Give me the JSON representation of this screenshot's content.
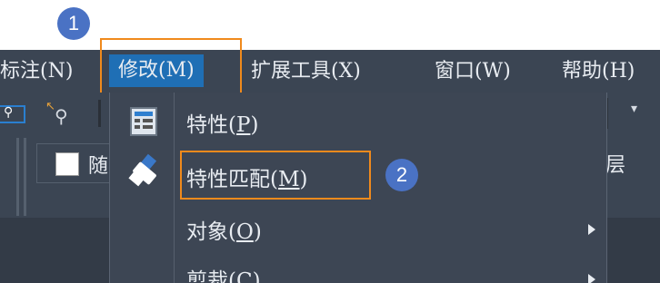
{
  "callouts": {
    "one": "1",
    "two": "2"
  },
  "menubar": {
    "items": [
      {
        "label": "标注(N)"
      },
      {
        "label": "修改(M)"
      },
      {
        "label": "扩展工具(X)"
      },
      {
        "label": "窗口(W)"
      },
      {
        "label": "帮助(H)"
      }
    ]
  },
  "toolbar": {
    "color_label": "随",
    "layer_label": "层"
  },
  "dropdown": {
    "items": [
      {
        "text": "特性(",
        "key": "P",
        "close": ")",
        "icon": "properties-icon"
      },
      {
        "text": "特性匹配(",
        "key": "M",
        "close": ")",
        "icon": "match-properties-brush-icon"
      },
      {
        "text": "对象(",
        "key": "O",
        "close": ")",
        "has_submenu": true
      },
      {
        "text": "剪裁(",
        "key": "C",
        "close": ")",
        "has_submenu": true
      }
    ]
  },
  "colors": {
    "menubar_bg": "#3b4553",
    "active_menu": "#1f6fb5",
    "highlight_box": "#f08a1c",
    "callout": "#4a72c4"
  }
}
